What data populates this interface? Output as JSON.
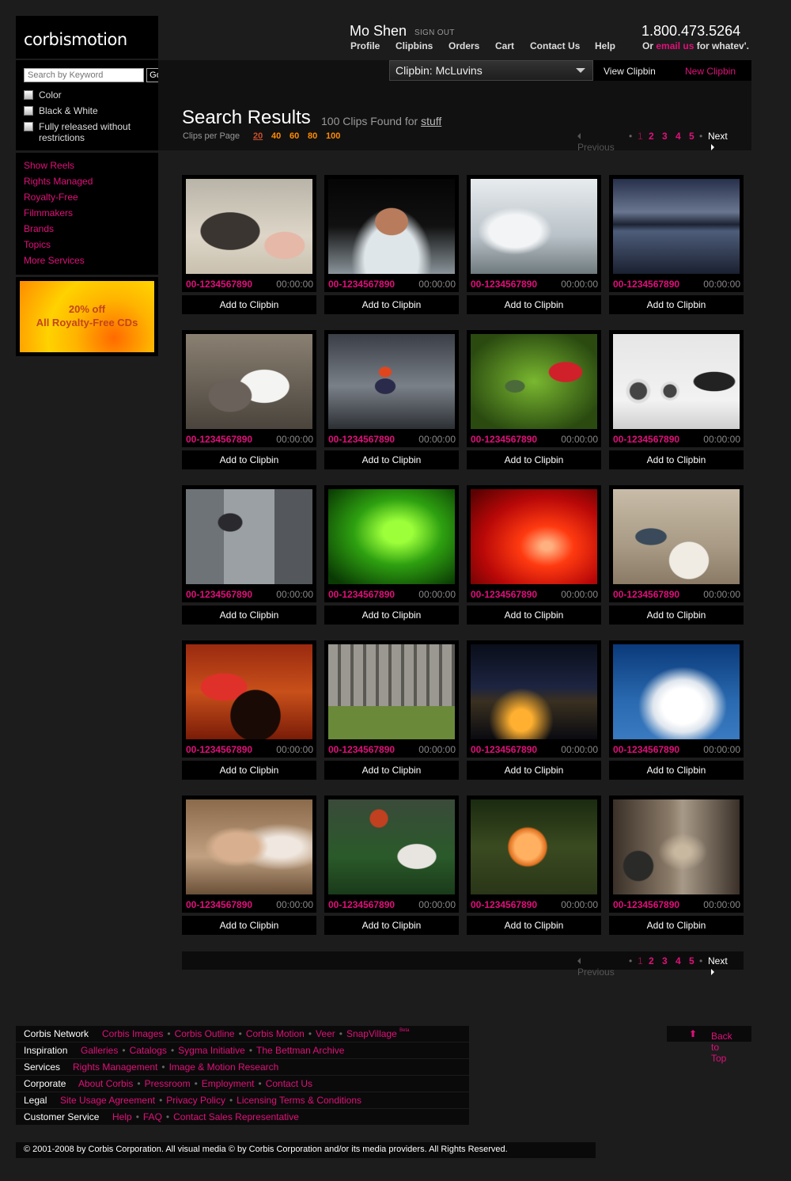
{
  "logo": {
    "text": "corbismotion"
  },
  "header": {
    "user_name": "Mo Shen",
    "sign_out": "SIGN OUT",
    "nav": [
      "Profile",
      "Clipbins",
      "Orders",
      "Cart",
      "Contact Us",
      "Help"
    ],
    "phone": "1.800.473.5264",
    "email_prefix": "Or ",
    "email_link": "email us",
    "email_suffix": " for whatev'."
  },
  "search": {
    "placeholder": "Search by Keyword",
    "go_label": "Go",
    "filters": [
      "Color",
      "Black & White",
      "Fully released without restrictions"
    ]
  },
  "sidebar": {
    "items": [
      "Show Reels",
      "Rights Managed",
      "Royalty-Free",
      "Filmmakers",
      "Brands",
      "Topics",
      "More Services"
    ]
  },
  "promo": {
    "line1": "20% off",
    "line2": "All Royalty-Free CDs",
    "colors": {
      "outer": "#ff8c00",
      "inner": "#ffd200",
      "text": "#c4441a"
    }
  },
  "clipbin": {
    "selected": "Clipbin: McLuvins",
    "view_label": "View Clipbin",
    "new_label": "New Clipbin"
  },
  "results": {
    "title": "Search Results",
    "found_prefix": "100 Clips Found for ",
    "query": "stuff",
    "clips_per_page_label": "Clips per Page",
    "per_page_options": [
      "20",
      "40",
      "60",
      "80",
      "100"
    ],
    "per_page_selected": "20"
  },
  "pagination": {
    "previous": "Previous",
    "pages": [
      "1",
      "2",
      "3",
      "4",
      "5"
    ],
    "current": "1",
    "next": "Next"
  },
  "clips": [
    {
      "id": "00-1234567890",
      "duration": "00:00:00",
      "action": "Add to Clipbin",
      "subject": "pigs"
    },
    {
      "id": "00-1234567890",
      "duration": "00:00:00",
      "action": "Add to Clipbin",
      "subject": "swimmer"
    },
    {
      "id": "00-1234567890",
      "duration": "00:00:00",
      "action": "Add to Clipbin",
      "subject": "white-horses"
    },
    {
      "id": "00-1234567890",
      "duration": "00:00:00",
      "action": "Add to Clipbin",
      "subject": "lake-pier"
    },
    {
      "id": "00-1234567890",
      "duration": "00:00:00",
      "action": "Add to Clipbin",
      "subject": "kitten-puppy"
    },
    {
      "id": "00-1234567890",
      "duration": "00:00:00",
      "action": "Add to Clipbin",
      "subject": "runner"
    },
    {
      "id": "00-1234567890",
      "duration": "00:00:00",
      "action": "Add to Clipbin",
      "subject": "hummingbird"
    },
    {
      "id": "00-1234567890",
      "duration": "00:00:00",
      "action": "Add to Clipbin",
      "subject": "laundromat"
    },
    {
      "id": "00-1234567890",
      "duration": "00:00:00",
      "action": "Add to Clipbin",
      "subject": "businessman-jump"
    },
    {
      "id": "00-1234567890",
      "duration": "00:00:00",
      "action": "Add to Clipbin",
      "subject": "green-abstract"
    },
    {
      "id": "00-1234567890",
      "duration": "00:00:00",
      "action": "Add to Clipbin",
      "subject": "red-tunnel"
    },
    {
      "id": "00-1234567890",
      "duration": "00:00:00",
      "action": "Add to Clipbin",
      "subject": "pillow-fight"
    },
    {
      "id": "00-1234567890",
      "duration": "00:00:00",
      "action": "Add to Clipbin",
      "subject": "bullfighter"
    },
    {
      "id": "00-1234567890",
      "duration": "00:00:00",
      "action": "Add to Clipbin",
      "subject": "papers-office"
    },
    {
      "id": "00-1234567890",
      "duration": "00:00:00",
      "action": "Add to Clipbin",
      "subject": "city-night"
    },
    {
      "id": "00-1234567890",
      "duration": "00:00:00",
      "action": "Add to Clipbin",
      "subject": "clouds"
    },
    {
      "id": "00-1234567890",
      "duration": "00:00:00",
      "action": "Add to Clipbin",
      "subject": "woman-lights"
    },
    {
      "id": "00-1234567890",
      "duration": "00:00:00",
      "action": "Add to Clipbin",
      "subject": "rugby"
    },
    {
      "id": "00-1234567890",
      "duration": "00:00:00",
      "action": "Add to Clipbin",
      "subject": "flower-macro"
    },
    {
      "id": "00-1234567890",
      "duration": "00:00:00",
      "action": "Add to Clipbin",
      "subject": "hallway-toys"
    }
  ],
  "footer": {
    "rows": [
      {
        "head": "Corbis Network",
        "links": [
          "Corbis Images",
          "Corbis Outline",
          "Corbis Motion",
          "Veer",
          "SnapVillage"
        ],
        "badge": "Beta"
      },
      {
        "head": "Inspiration",
        "links": [
          "Galleries",
          "Catalogs",
          "Sygma Initiative",
          "The Bettman Archive"
        ]
      },
      {
        "head": "Services",
        "links": [
          "Rights Management",
          "Image & Motion Research"
        ]
      },
      {
        "head": "Corporate",
        "links": [
          "About Corbis",
          "Pressroom",
          "Employment",
          "Contact Us"
        ]
      },
      {
        "head": "Legal",
        "links": [
          "Site Usage Agreement",
          "Privacy Policy",
          "Licensing Terms & Conditions"
        ]
      },
      {
        "head": "Customer Service",
        "links": [
          "Help",
          "FAQ",
          "Contact Sales Representative"
        ]
      }
    ],
    "back_to_top": "Back to Top",
    "copyright": "© 2001-2008 by Corbis Corporation.  All visual media © by Corbis Corporation and/or its media providers.  All Rights Reserved."
  },
  "colors": {
    "accent": "#e0107a",
    "orange": "#ff8c00",
    "background": "#1c1c1c",
    "panel": "#000000"
  }
}
